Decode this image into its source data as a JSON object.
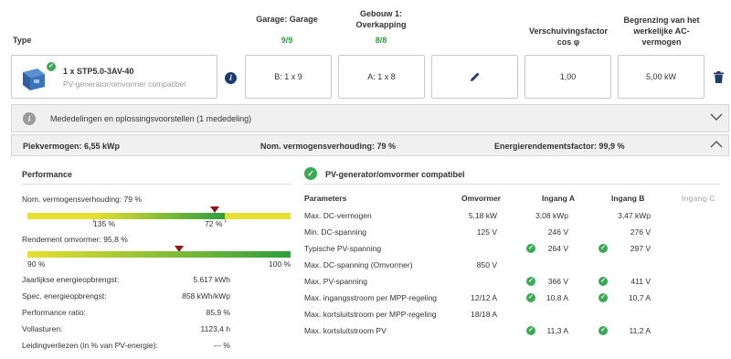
{
  "header": {
    "type_label": "Type",
    "col1_title": "Garage: Garage",
    "col1_count": "9/9",
    "col2_title_l1": "Gebouw 1:",
    "col2_title_l2": "Overkapping",
    "col2_count": "8/8",
    "col4_title_l1": "Verschuivingsfactor",
    "col4_title_l2": "cos φ",
    "col5_title_l1": "Begrenzing van het",
    "col5_title_l2": "werkelijke AC-",
    "col5_title_l3": "vermogen"
  },
  "inverter": {
    "name": "1 x STP5.0-3AV-40",
    "subtitle": "PV-generator/omvormer compatibel",
    "string1": "B: 1 x 9",
    "string2": "A: 1 x 8",
    "cos_phi": "1,00",
    "ac_limit": "5,00 kW"
  },
  "notices": {
    "label": "Mededelingen en oplossingsvoorstellen (1 mededeling)"
  },
  "summary": {
    "peak_power": "Piekvermogen: 6,55 kWp",
    "nominal_ratio": "Nom. vermogensverhouding: 79 %",
    "energy_factor": "Energierendementsfactor: 99,9 %"
  },
  "performance": {
    "title": "Performance",
    "ratio_label": "Nom. vermogensverhouding: 79 %",
    "ratio_tick1": "135 %",
    "ratio_tick2": "72 %",
    "ratio_value": 79,
    "efficiency_label": "Rendement omvormer: 95,8 %",
    "eff_min": "90 %",
    "eff_max": "100 %",
    "efficiency_value": 95.8,
    "rows": [
      {
        "label": "Jaarlijkse energieopbrengst:",
        "value": "5.617 kWh"
      },
      {
        "label": "Spec. energieopbrengst:",
        "value": "858 kWh/kWp"
      },
      {
        "label": "Performance ratio:",
        "value": "85,9 %"
      },
      {
        "label": "Vollasturen:",
        "value": "1123,4 h"
      },
      {
        "label": "Leidingverliezen (in % van PV-energie):",
        "value": "--- %"
      }
    ]
  },
  "compat": {
    "title": "PV-generator/omvormer compatibel",
    "headers": [
      "Parameters",
      "Omvormer",
      "Ingang A",
      "Ingang B",
      "Ingang C"
    ],
    "rows": [
      {
        "param": "Max. DC-vermogen",
        "inv": "5,18 kW",
        "a": "3,08 kWp",
        "b": "3,47 kWp",
        "ca": false,
        "cb": false
      },
      {
        "param": "Min. DC-spanning",
        "inv": "125 V",
        "a": "246 V",
        "b": "276 V",
        "ca": false,
        "cb": false
      },
      {
        "param": "Typische PV-spanning",
        "inv": "",
        "a": "264 V",
        "b": "297 V",
        "ca": true,
        "cb": true
      },
      {
        "param": "Max. DC-spanning (Omvormer)",
        "inv": "850 V",
        "a": "",
        "b": "",
        "ca": false,
        "cb": false
      },
      {
        "param": "Max. PV-spanning",
        "inv": "",
        "a": "366 V",
        "b": "411 V",
        "ca": true,
        "cb": true
      },
      {
        "param": "Max. ingangsstroom per MPP-regeling",
        "inv": "12/12 A",
        "a": "10,8 A",
        "b": "10,7 A",
        "ca": true,
        "cb": true
      },
      {
        "param": "Max. kortsluitstroom per MPP-regeling",
        "inv": "18/18 A",
        "a": "",
        "b": "",
        "ca": false,
        "cb": false
      },
      {
        "param": "Max. kortsluitstroom PV",
        "inv": "",
        "a": "11,3 A",
        "b": "11,2 A",
        "ca": true,
        "cb": true
      }
    ]
  }
}
